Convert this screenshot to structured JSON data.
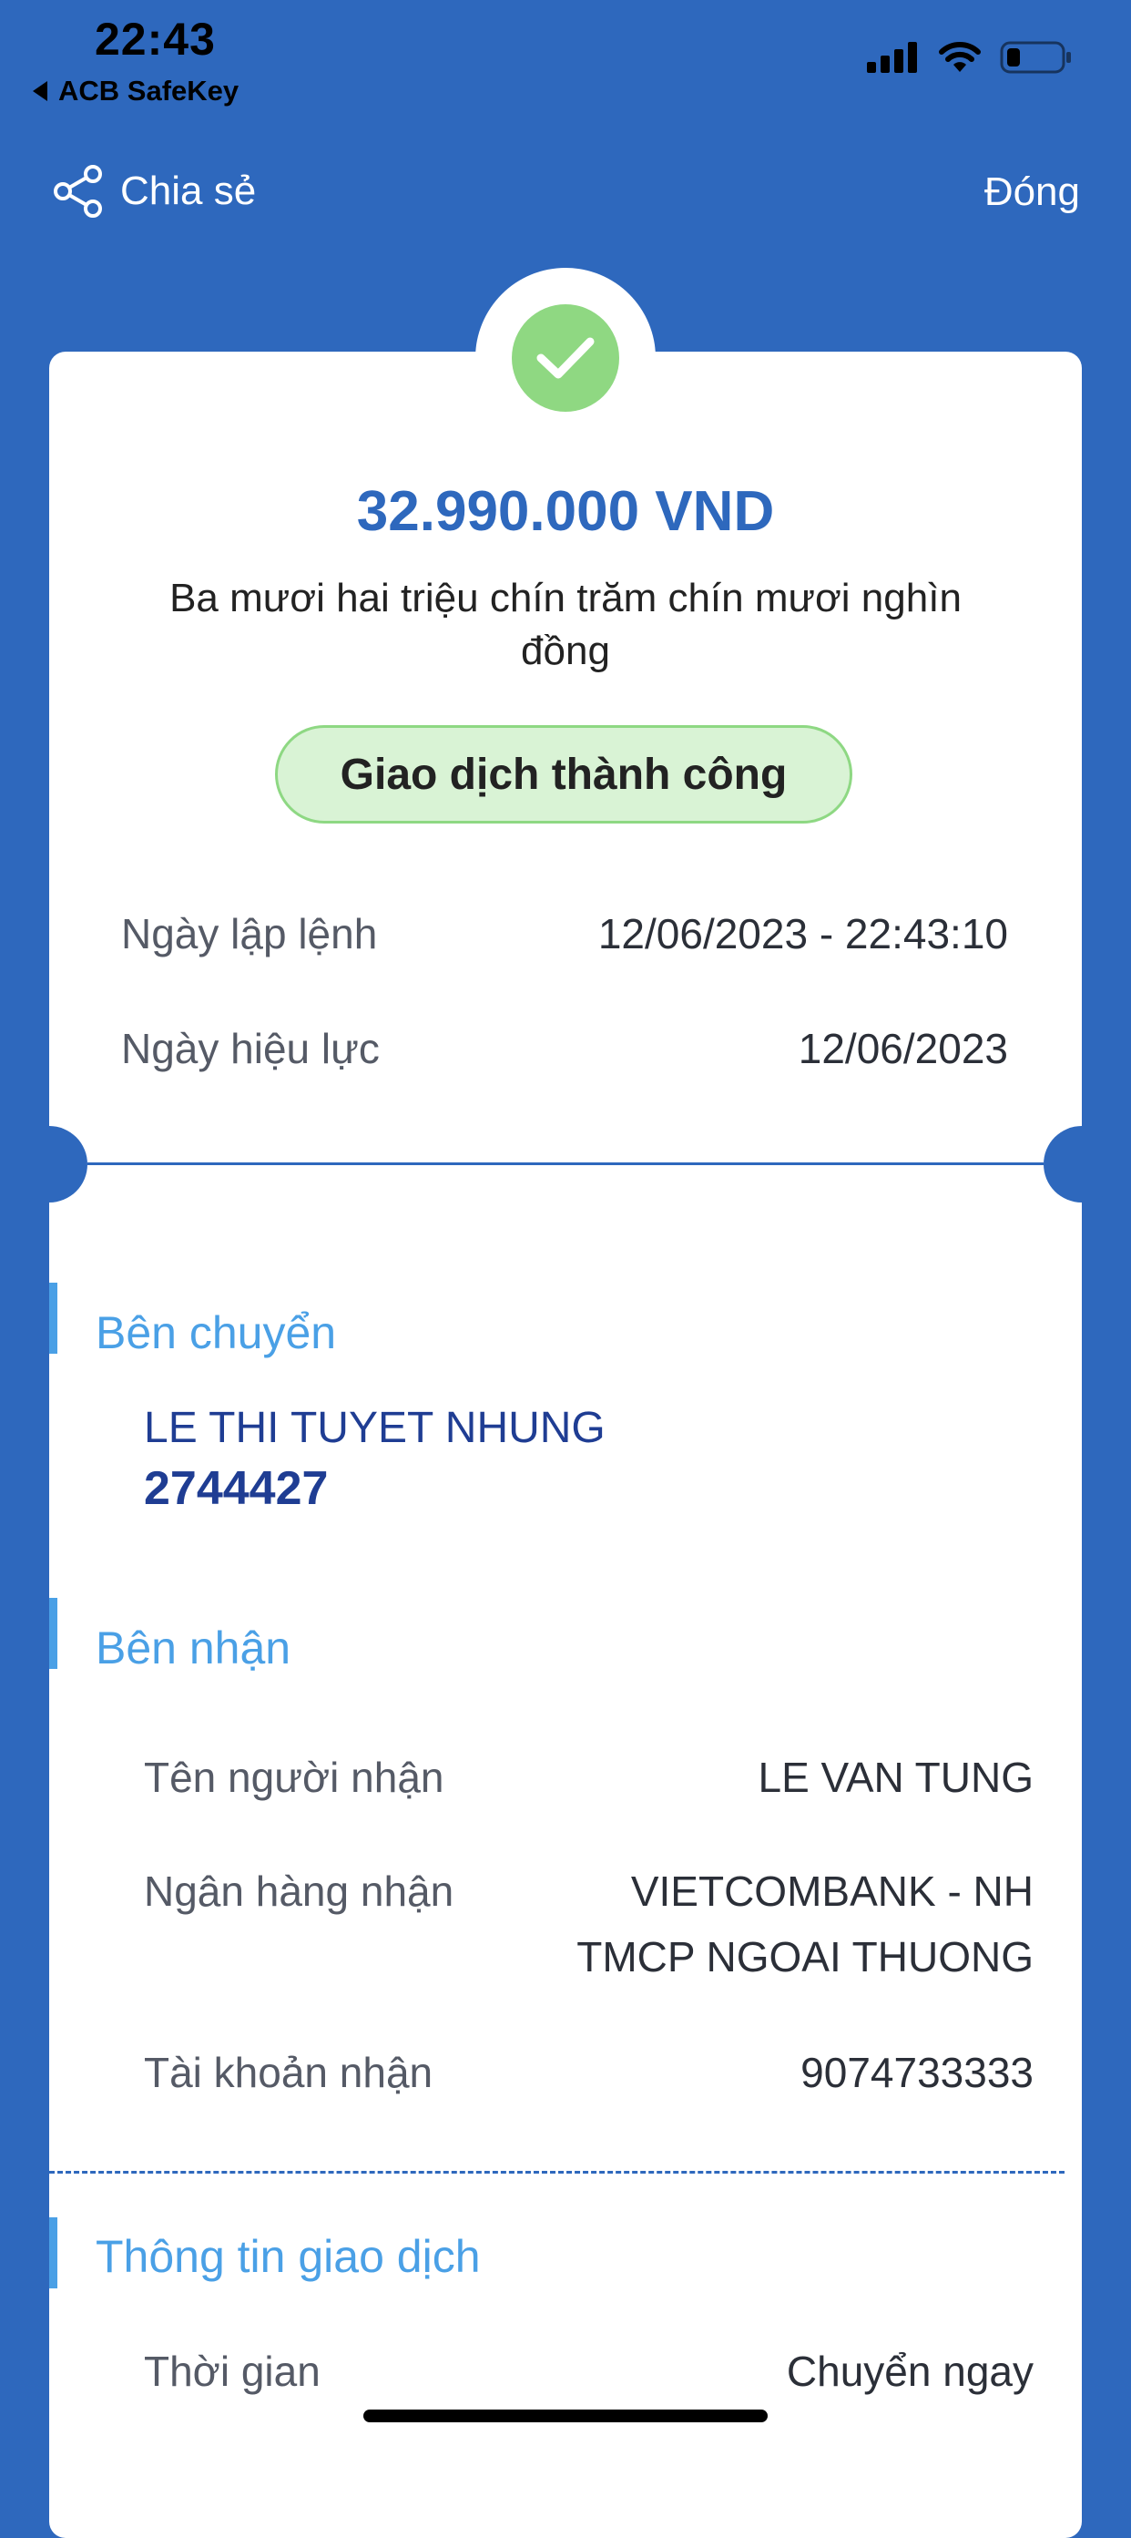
{
  "status_bar": {
    "time": "22:43",
    "back_app_label": "ACB SafeKey",
    "icons": [
      "cellular-signal-icon",
      "wifi-icon",
      "battery-icon"
    ]
  },
  "nav": {
    "share_label": "Chia sẻ",
    "close_label": "Đóng"
  },
  "receipt": {
    "amount": "32.990.000 VND",
    "amount_in_words": "Ba mươi hai triệu chín trăm chín mươi nghìn đồng",
    "status": "Giao dịch thành công",
    "order_date_label": "Ngày lập lệnh",
    "order_date_value": "12/06/2023 - 22:43:10",
    "effective_date_label": "Ngày hiệu lực",
    "effective_date_value": "12/06/2023"
  },
  "sender": {
    "title": "Bên chuyển",
    "name": "LE THI TUYET NHUNG",
    "account": "2744427"
  },
  "recipient": {
    "title": "Bên nhận",
    "name_label": "Tên người nhận",
    "name_value": "LE VAN TUNG",
    "bank_label": "Ngân hàng nhận",
    "bank_line1": "VIETCOMBANK - NH",
    "bank_line2": "TMCP NGOAI THUONG",
    "account_label": "Tài khoản nhận",
    "account_value": "9074733333"
  },
  "transaction_info": {
    "title": "Thông tin giao dịch",
    "time_label": "Thời gian",
    "time_value": "Chuyển ngay"
  },
  "colors": {
    "background": "#2e68bd",
    "success_green": "#8fd882",
    "section_accent": "#4aa0e6",
    "account_text": "#1f3d93"
  }
}
